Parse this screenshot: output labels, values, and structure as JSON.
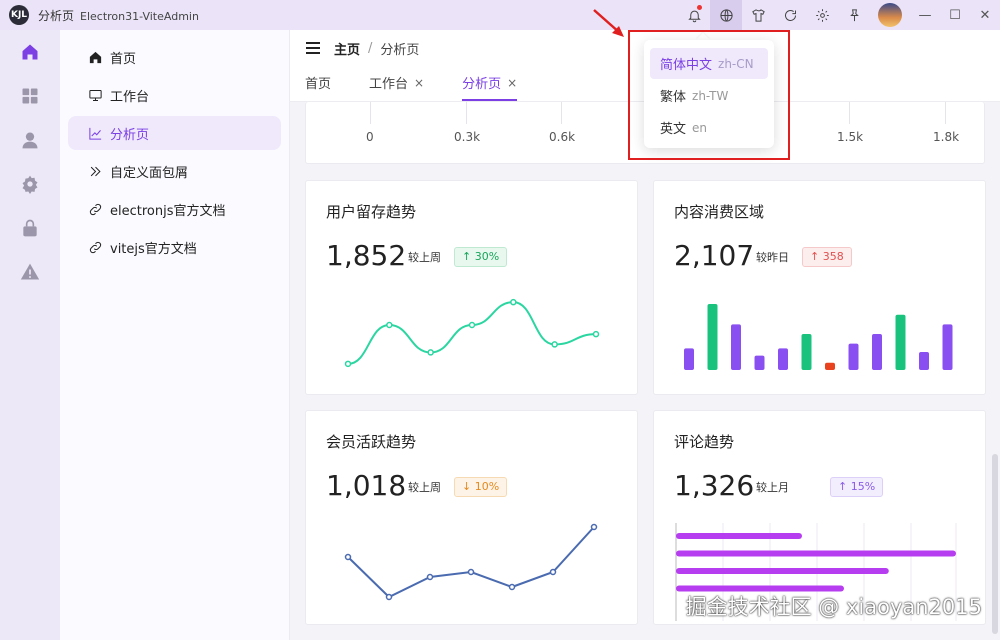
{
  "titlebar": {
    "title": "分析页",
    "subtitle": "Electron31-ViteAdmin",
    "logo_text": "KJL"
  },
  "colors": {
    "accent": "#7b3fe4",
    "green": "#19c37d",
    "red": "#e33",
    "line_green": "#2bd6a0",
    "line_blue": "#4a6bb0",
    "bar_purple": "#8a4ff0",
    "hbar_purple": "#b73ef0"
  },
  "sidebar": {
    "rail_icons": [
      "home-icon",
      "grid-icon",
      "user-icon",
      "settings-icon",
      "lock-icon",
      "warning-icon"
    ],
    "items": [
      {
        "label": "首页",
        "icon": "home-icon"
      },
      {
        "label": "工作台",
        "icon": "monitor-icon"
      },
      {
        "label": "分析页",
        "icon": "chart-icon"
      },
      {
        "label": "自定义面包屑",
        "icon": "double-chevron-icon"
      },
      {
        "label": "electronjs官方文档",
        "icon": "link-icon"
      },
      {
        "label": "vitejs官方文档",
        "icon": "link-icon"
      }
    ]
  },
  "breadcrumb": {
    "home": "主页",
    "separator": "/",
    "current": "分析页"
  },
  "tabs": [
    {
      "label": "首页",
      "closable": false
    },
    {
      "label": "工作台",
      "closable": true
    },
    {
      "label": "分析页",
      "closable": true
    }
  ],
  "tab_close": "×",
  "top_axis": {
    "labels": [
      "0",
      "0.3k",
      "0.6k",
      "1.5k",
      "1.8k"
    ]
  },
  "language_menu": {
    "items": [
      {
        "label": "简体中文",
        "code": "zh-CN",
        "selected": true
      },
      {
        "label": "繁体",
        "code": "zh-TW",
        "selected": false
      },
      {
        "label": "英文",
        "code": "en",
        "selected": false
      }
    ]
  },
  "cards": [
    {
      "title": "用户留存趋势",
      "value": "1,852",
      "compare": "较上周",
      "change": "↑ 30%"
    },
    {
      "title": "内容消费区域",
      "value": "2,107",
      "compare": "较昨日",
      "change": "↑ 358"
    },
    {
      "title": "会员活跃趋势",
      "value": "1,018",
      "compare": "较上周",
      "change": "↓ 10%"
    },
    {
      "title": "评论趋势",
      "value": "1,326",
      "compare": "较上月",
      "change": "↑ 15%"
    }
  ],
  "chart_data": [
    {
      "type": "line",
      "series": [
        {
          "values": [
            8,
            42,
            18,
            42,
            62,
            25,
            34
          ]
        }
      ],
      "ylim": [
        0,
        70
      ]
    },
    {
      "type": "bar",
      "series": [
        {
          "values": [
            18,
            55,
            38,
            12,
            18,
            30,
            6,
            22,
            30,
            46,
            15,
            38
          ],
          "colors": [
            "purple",
            "green",
            "purple",
            "purple",
            "purple",
            "green",
            "red",
            "purple",
            "purple",
            "green",
            "purple",
            "purple"
          ]
        }
      ],
      "ylim": [
        0,
        60
      ]
    },
    {
      "type": "line",
      "series": [
        {
          "values": [
            50,
            10,
            30,
            35,
            20,
            35,
            80
          ]
        }
      ],
      "ylim": [
        0,
        90
      ]
    },
    {
      "type": "bar",
      "orientation": "horizontal",
      "series": [
        {
          "values": [
            45,
            100,
            76,
            60
          ]
        }
      ],
      "xlim": [
        0,
        100
      ]
    }
  ],
  "watermark": "掘金技术社区 @ xiaoyan2015"
}
